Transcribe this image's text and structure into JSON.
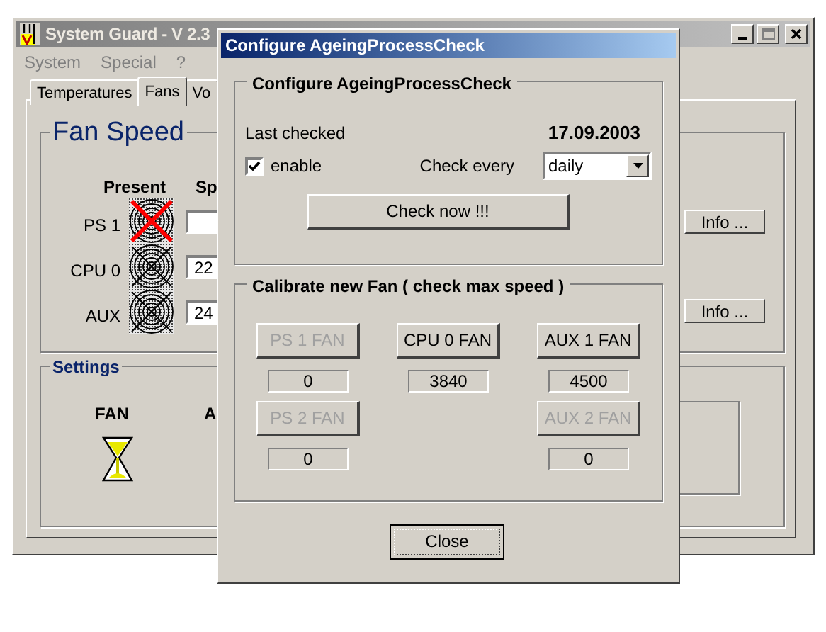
{
  "main_window": {
    "title": "System Guard - V 2.3",
    "active": false,
    "menu": [
      {
        "label": "System"
      },
      {
        "label": "Special"
      },
      {
        "label": "?"
      }
    ],
    "tabs": [
      {
        "label": "Temperatures",
        "selected": false
      },
      {
        "label": "Fans",
        "selected": true
      },
      {
        "label": "Vo",
        "selected": false
      }
    ],
    "fan_speed": {
      "title": "Fan Speed",
      "columns": [
        "Present",
        "Sp"
      ],
      "rows": [
        {
          "label": "PS 1",
          "present": false
        },
        {
          "label": "CPU 0",
          "present": true,
          "speed": "22"
        },
        {
          "label": "AUX",
          "present": true,
          "speed": "24"
        }
      ]
    },
    "info_buttons": [
      "Info ...",
      "Info ..."
    ],
    "settings": {
      "title": "Settings",
      "columns": [
        "FAN",
        "A"
      ]
    }
  },
  "dialog": {
    "title": "Configure AgeingProcessCheck",
    "active": true,
    "check_group": {
      "title": "Configure AgeingProcessCheck",
      "last_checked_label": "Last checked",
      "last_checked_value": "17.09.2003",
      "enable": {
        "label": "enable",
        "checked": true
      },
      "interval_label": "Check every",
      "interval": "daily",
      "check_button": "Check now !!!"
    },
    "calibrate_group": {
      "title": "Calibrate new Fan ( check max speed )",
      "rows": [
        {
          "cells": [
            {
              "kind": "fan",
              "button": "PS 1 FAN",
              "disabled": true,
              "value": "0"
            },
            {
              "kind": "fan",
              "button": "CPU 0 FAN",
              "disabled": false,
              "value": "3840"
            },
            {
              "kind": "fan",
              "button": "AUX 1 FAN",
              "disabled": false,
              "value": "4500"
            }
          ]
        },
        {
          "cells": [
            {
              "kind": "fan",
              "button": "PS 2 FAN",
              "disabled": true,
              "value": "0"
            },
            {
              "kind": "empty"
            },
            {
              "kind": "fan",
              "button": "AUX 2 FAN",
              "disabled": true,
              "value": "0"
            }
          ]
        }
      ]
    },
    "close_button": "Close"
  }
}
